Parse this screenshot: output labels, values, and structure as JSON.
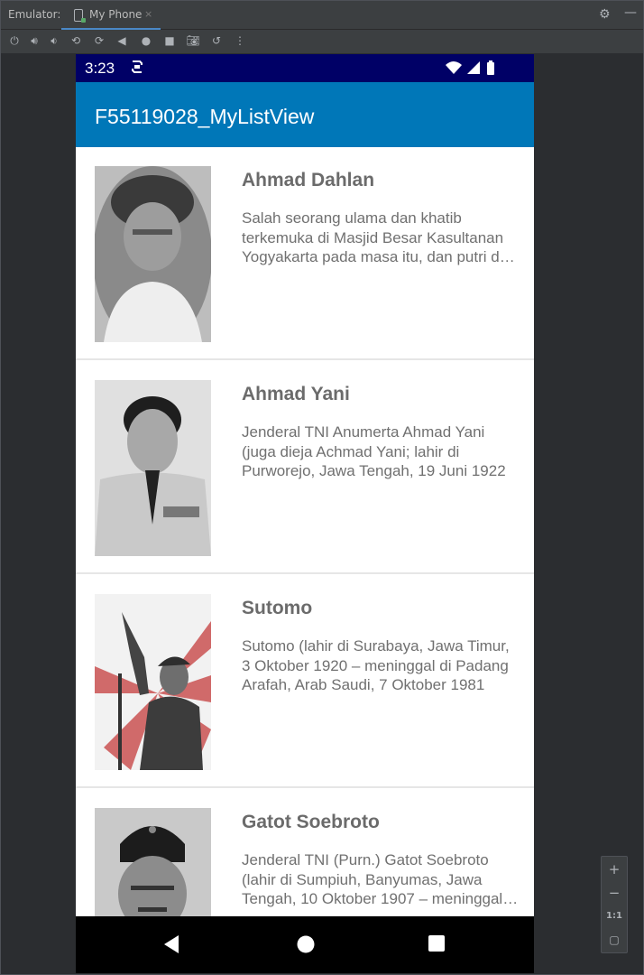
{
  "emulator": {
    "label": "Emulator:",
    "tab_title": "My Phone",
    "tab_close": "×",
    "toolbar_icons": [
      "power-icon",
      "volume-up-icon",
      "volume-down-icon",
      "rotate-left-icon",
      "rotate-right-icon",
      "back-icon",
      "home-icon",
      "overview-icon",
      "camera-icon",
      "snapshot-icon",
      "more-icon"
    ]
  },
  "statusbar": {
    "time": "3:23"
  },
  "appbar": {
    "title": "F55119028_MyListView"
  },
  "heroes": [
    {
      "name": "Ahmad Dahlan",
      "description": "Salah seorang ulama dan khatib terkemuka di Masjid Besar Kasultanan Yogyakarta pada masa itu, dan putri dari H. Ibrahim"
    },
    {
      "name": "Ahmad Yani",
      "description": "Jenderal TNI Anumerta Ahmad Yani (juga dieja Achmad Yani; lahir di Purworejo, Jawa Tengah, 19 Juni 1922"
    },
    {
      "name": "Sutomo",
      "description": "Sutomo (lahir di Surabaya, Jawa Timur, 3 Oktober 1920 – meninggal di Padang Arafah, Arab Saudi, 7 Oktober 1981"
    },
    {
      "name": "Gatot Soebroto",
      "description": "Jenderal TNI (Purn.) Gatot Soebroto (lahir di Sumpiuh, Banyumas, Jawa Tengah, 10 Oktober 1907 – meninggal di Jakarta"
    }
  ],
  "zoom": {
    "plus": "+",
    "minus": "−",
    "one_to_one": "1:1"
  },
  "colors": {
    "statusbar": "#000066",
    "appbar": "#0077b8",
    "navbar": "#000000"
  }
}
